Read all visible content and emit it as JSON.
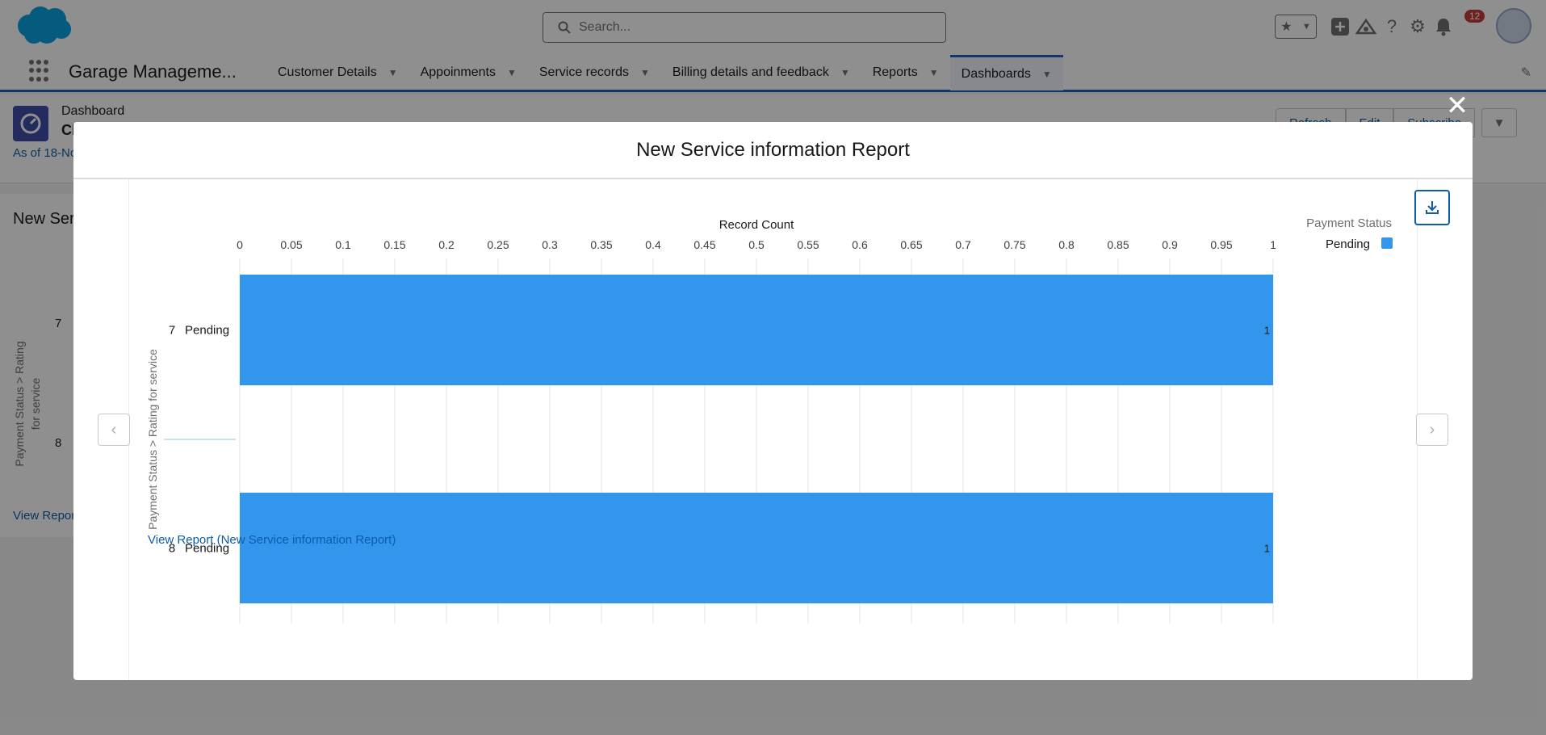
{
  "global_header": {
    "search_placeholder": "Search...",
    "notification_count": "12"
  },
  "nav": {
    "app_name": "Garage Manageme...",
    "items": [
      {
        "label": "Customer Details"
      },
      {
        "label": "Appoinments"
      },
      {
        "label": "Service records"
      },
      {
        "label": "Billing details and feedback"
      },
      {
        "label": "Reports"
      },
      {
        "label": "Dashboards"
      }
    ]
  },
  "page_header": {
    "label": "Dashboard",
    "title": "Cl",
    "as_of": "As of 18-No",
    "buttons": [
      "Refresh",
      "Edit",
      "Subscribe"
    ]
  },
  "widget": {
    "title": "New Ser",
    "axis_label": "Payment Status > Rating for service",
    "ticks": [
      "7",
      "8"
    ],
    "link": "View Repor"
  },
  "modal": {
    "title": "New Service information Report",
    "close_symbol": "✕",
    "link": "View Report (New Service information Report)"
  },
  "chart_data": {
    "type": "bar",
    "orientation": "horizontal",
    "title": "",
    "xlabel": "Record Count",
    "ylabel": "Payment Status > Rating for service",
    "xlim": [
      0,
      1
    ],
    "xticks": [
      "0",
      "0.05",
      "0.1",
      "0.15",
      "0.2",
      "0.25",
      "0.3",
      "0.35",
      "0.4",
      "0.45",
      "0.5",
      "0.55",
      "0.6",
      "0.65",
      "0.7",
      "0.75",
      "0.8",
      "0.85",
      "0.9",
      "0.95",
      "1"
    ],
    "groups": [
      {
        "group": "7",
        "category": "Pending",
        "value": 1
      },
      {
        "group": "8",
        "category": "Pending",
        "value": 1
      }
    ],
    "legend": {
      "title": "Payment Status",
      "position": "top-right",
      "entries": [
        {
          "name": "Pending",
          "color": "#3296ed"
        }
      ]
    },
    "bar_color": "#3296ed",
    "grid": true
  }
}
